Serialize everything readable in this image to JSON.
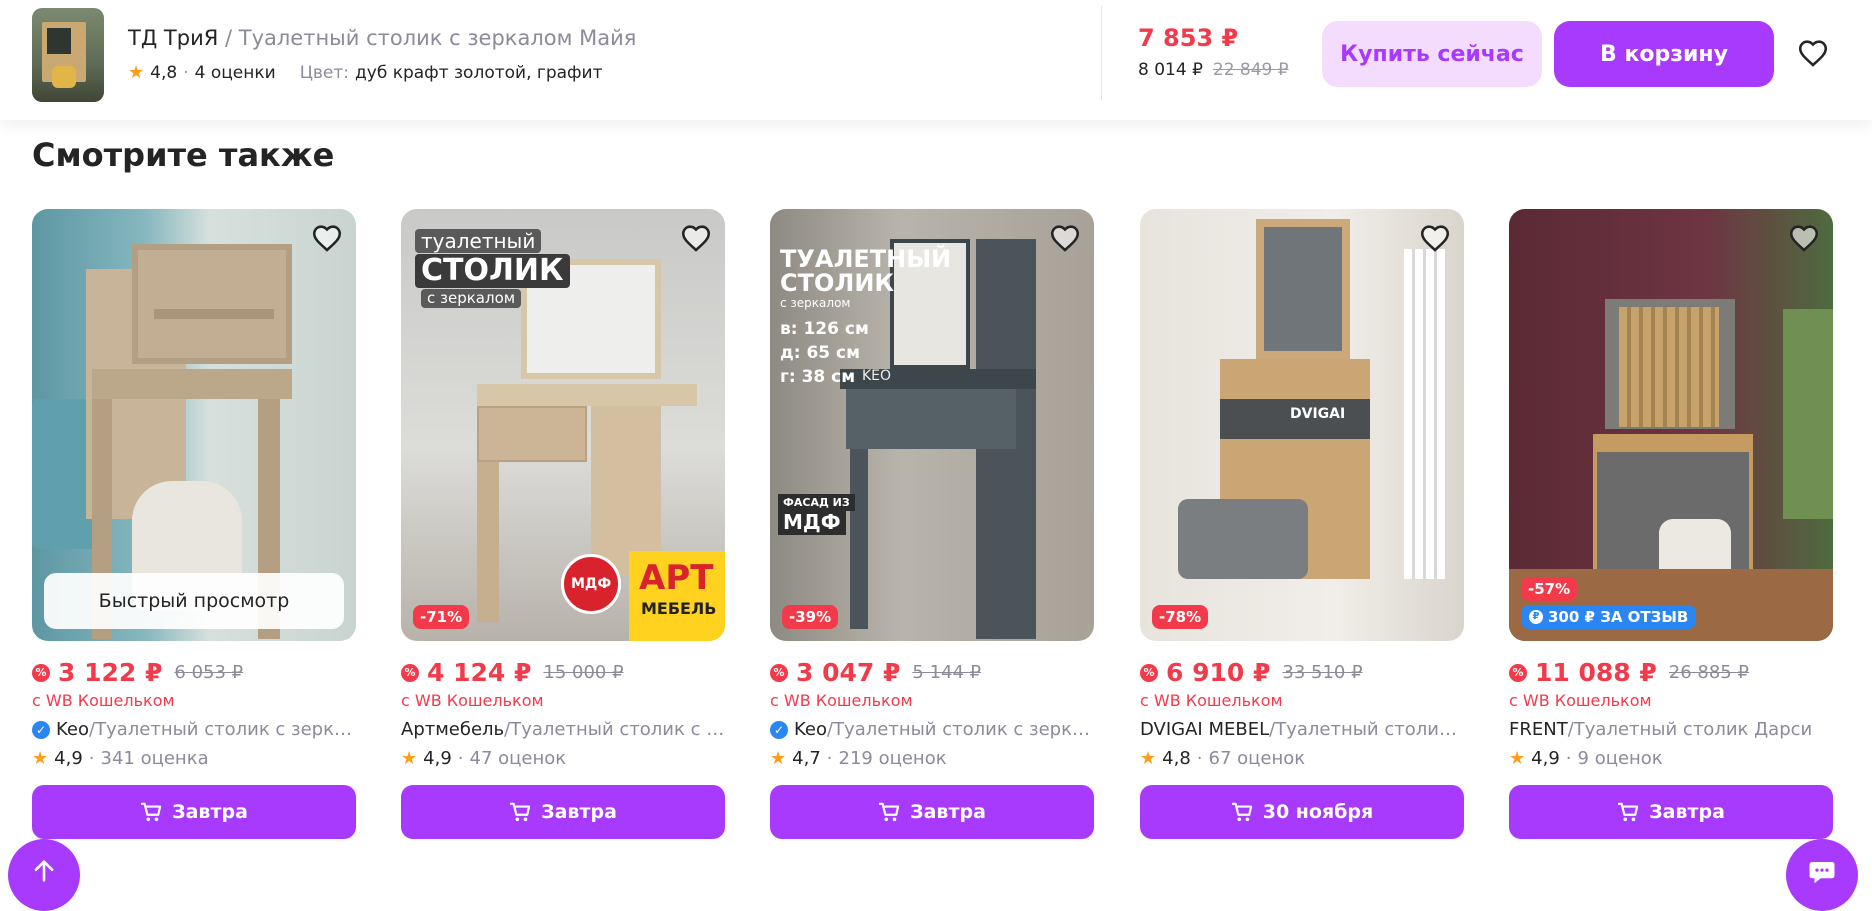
{
  "header": {
    "brand": "ТД ТриЯ",
    "separator": " / ",
    "product_name": "Туалетный столик с зеркалом Майя",
    "rating": "4,8",
    "dot": "·",
    "reviews": "4 оценки",
    "color_label": "Цвет:",
    "color_value": "дуб крафт золотой, графит",
    "price_now": "7 853 ₽",
    "price_regular": "8 014 ₽",
    "price_old": "22 849 ₽",
    "buy_now_label": "Купить сейчас",
    "add_to_cart_label": "В корзину"
  },
  "section": {
    "title": "Смотрите также"
  },
  "colors": {
    "accent": "#a73afd",
    "accent_light": "#f4dcff",
    "price_red": "#f23a4b",
    "muted": "#8b8b99",
    "star": "#ff9c1a"
  },
  "products": [
    {
      "quick_view": "Быстрый просмотр",
      "price_now": "3 122 ₽",
      "price_old": "6 053 ₽",
      "wallet": "с WB Кошельком",
      "verified": true,
      "brand": "Keo",
      "sep": " / ",
      "name": "Туалетный столик с зеркалом",
      "rating": "4,9",
      "dot": "·",
      "reviews": "341 оценка",
      "delivery": "Завтра"
    },
    {
      "discount": "-71%",
      "img_text_1": "туалетный",
      "img_text_2": "СТОЛИК",
      "img_text_3": "с зеркалом",
      "img_badge_1": "МДФ",
      "img_badge_2": "АРТ",
      "img_badge_3": "МЕБЕЛЬ",
      "price_now": "4 124 ₽",
      "price_old": "15 000 ₽",
      "wallet": "с WB Кошельком",
      "verified": false,
      "brand": "Артмебель",
      "sep": " / ",
      "name": "Туалетный столик с зеркалом",
      "rating": "4,9",
      "dot": "·",
      "reviews": "47 оценок",
      "delivery": "Завтра"
    },
    {
      "discount": "-39%",
      "img_text_1": "ТУАЛЕТНЫЙ",
      "img_text_2": "СТОЛИК",
      "img_text_3": "с зеркалом",
      "img_dim_1": "в: 126 см",
      "img_dim_2": "д: 65 см",
      "img_dim_3": "г: 38 см",
      "img_brand": "KEO",
      "img_badge_1": "ФАСАД ИЗ",
      "img_badge_2": "МДФ",
      "price_now": "3 047 ₽",
      "price_old": "5 144 ₽",
      "wallet": "с WB Кошельком",
      "verified": true,
      "brand": "Keo",
      "sep": " / ",
      "name": "Туалетный столик с зеркалом",
      "rating": "4,7",
      "dot": "·",
      "reviews": "219 оценок",
      "delivery": "Завтра"
    },
    {
      "discount": "-78%",
      "img_brand": "DVIGAI",
      "price_now": "6 910 ₽",
      "price_old": "33 510 ₽",
      "wallet": "с WB Кошельком",
      "verified": false,
      "brand": "DVIGAI MEBEL",
      "sep": " / ",
      "name": "Туалетный столик с зеркалом",
      "rating": "4,8",
      "dot": "·",
      "reviews": "67 оценок",
      "delivery": "30 ноября"
    },
    {
      "discount": "-57%",
      "bonus": "300 ₽ ЗА ОТЗЫВ",
      "price_now": "11 088 ₽",
      "price_old": "26 885 ₽",
      "wallet": "с WB Кошельком",
      "verified": false,
      "brand": "FRENT",
      "sep": " / ",
      "name": "Туалетный столик Дарси",
      "rating": "4,9",
      "dot": "·",
      "reviews": "9 оценок",
      "delivery": "Завтра"
    }
  ]
}
